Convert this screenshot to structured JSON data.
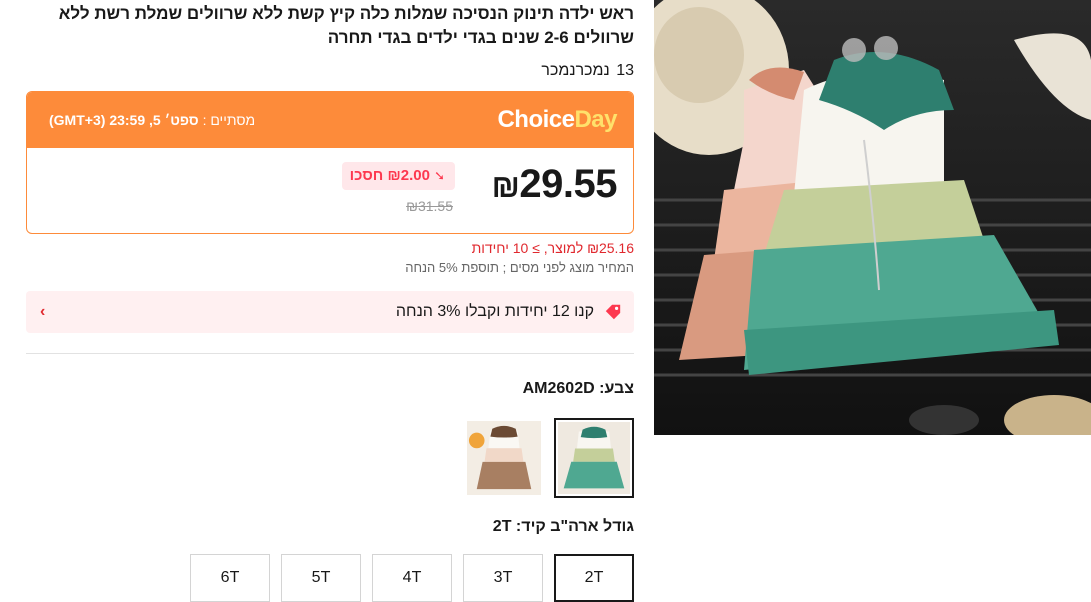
{
  "product": {
    "title": "ראש ילדה תינוק הנסיכה שמלות כלה קיץ קשת ללא שרוולים שמלת רשת ללא שרוולים 2-6 שנים בגדי ילדים בגדי תחרה",
    "sold_count": "13",
    "sold_label": "נמכרנמכר"
  },
  "choice": {
    "logo_part1": "Choice",
    "logo_part2": "Day",
    "ends_label": "מסתיים :",
    "ends_time": "ספט׳ 5, 23:59 (GMT+3)"
  },
  "price": {
    "current": "29.55",
    "currency": "₪",
    "discount": "₪2.00 חסכו",
    "original": "₪31.55"
  },
  "bulk_price": "₪25.16 למוצר, ≥ 10 יחידות",
  "tax_note": "המחיר מוצג לפני מסים ; תוספת 5% הנחה",
  "coupon": {
    "text": "קנו 12 יחידות וקבלו 3% הנחה",
    "icon": "tag-icon",
    "chevron": "›"
  },
  "color": {
    "label": "צבע:",
    "value": "AM2602D",
    "options": [
      {
        "name": "green-dress",
        "selected": true
      },
      {
        "name": "brown-dress",
        "selected": false
      }
    ]
  },
  "size": {
    "label": "גודל ארה\"ב קיד:",
    "value": "2T",
    "options": [
      "2T",
      "3T",
      "4T",
      "5T",
      "6T"
    ],
    "selected": "2T"
  },
  "colors": {
    "accent_orange": "#fd8b3a",
    "sale_red": "#fd384f",
    "bulk_red": "#e0282e",
    "coupon_bg": "#fff0f1"
  }
}
